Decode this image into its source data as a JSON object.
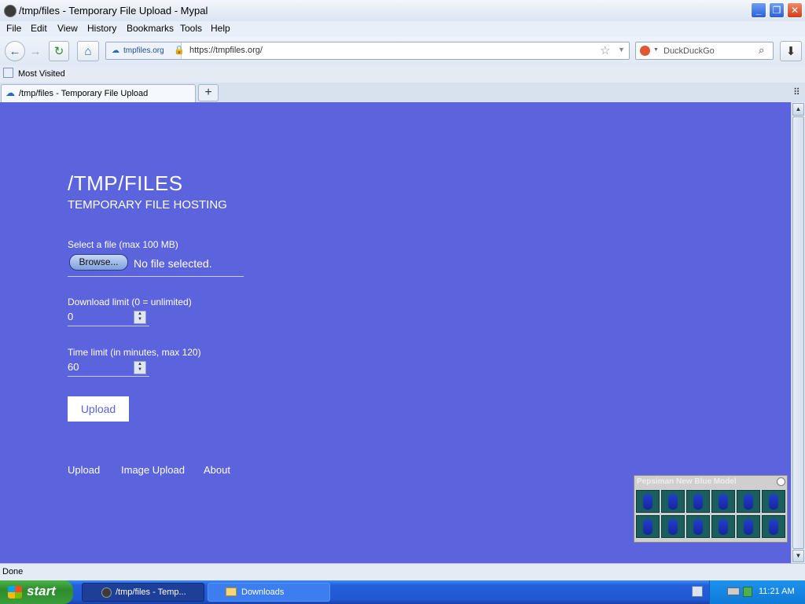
{
  "window": {
    "title": "/tmp/files - Temporary File Upload - Mypal"
  },
  "menu": [
    "File",
    "Edit",
    "View",
    "History",
    "Bookmarks",
    "Tools",
    "Help"
  ],
  "nav": {
    "site_identity": "tmpfiles.org",
    "url": "https://tmpfiles.org/",
    "search_placeholder": "DuckDuckGo"
  },
  "bookmarks": {
    "items": [
      "Most Visited"
    ]
  },
  "tabs": [
    {
      "label": "/tmp/files - Temporary File Upload",
      "active": true
    }
  ],
  "page": {
    "title": "/TMP/FILES",
    "subtitle": "TEMPORARY FILE HOSTING",
    "file_label": "Select a file (max 100 MB)",
    "browse_label": "Browse...",
    "no_file_text": "No file selected.",
    "download_limit_label": "Download limit (0 = unlimited)",
    "download_limit_value": "0",
    "time_limit_label": "Time limit (in minutes, max 120)",
    "time_limit_value": "60",
    "upload_button": "Upload",
    "footer_links": [
      "Upload",
      "Image Upload",
      "About"
    ]
  },
  "widget": {
    "title": "Pepsiman New Blue Model"
  },
  "status": {
    "text": "Done"
  },
  "taskbar": {
    "start_label": "start",
    "tasks": [
      "/tmp/files - Temp...",
      "Downloads"
    ],
    "clock": "11:21 AM"
  },
  "colors": {
    "page_background": "#5b63dd",
    "taskbar": "#245edb"
  }
}
